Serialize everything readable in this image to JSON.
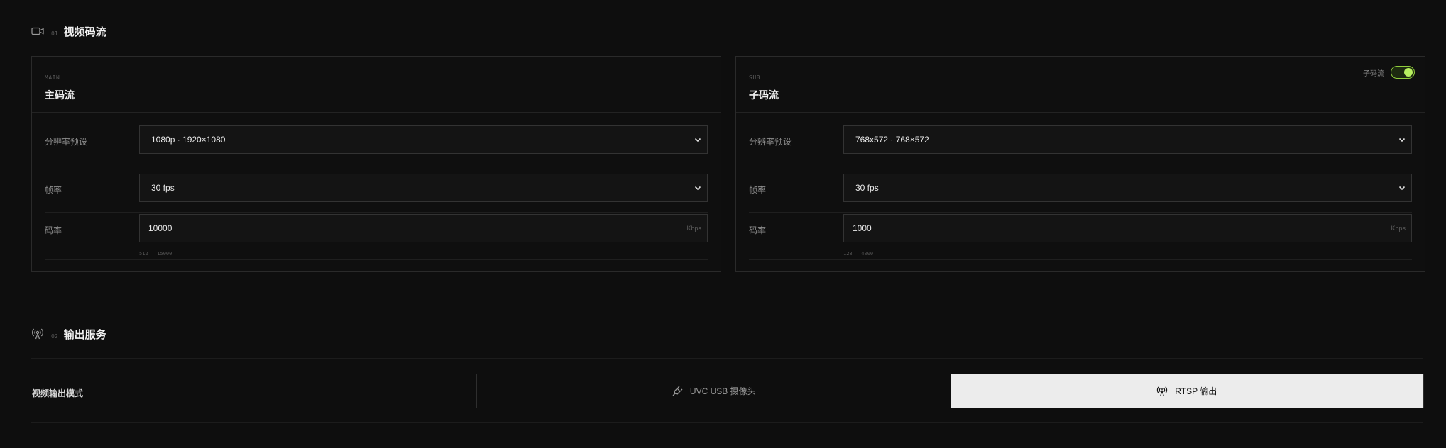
{
  "video_section": {
    "icon": "video-camera-icon",
    "number": "01",
    "title": "视频码流"
  },
  "main_stream": {
    "tag": "MAIN",
    "name": "主码流",
    "resolution_label": "分辨率预设",
    "resolution_value": "1080p · 1920×1080",
    "framerate_label": "帧率",
    "framerate_value": "30 fps",
    "bitrate_label": "码率",
    "bitrate_value": "10000",
    "bitrate_unit": "Kbps",
    "bitrate_hint": "512 – 15000"
  },
  "sub_stream": {
    "tag": "SUB",
    "name": "子码流",
    "toggle_label": "子码流",
    "toggle_on": true,
    "resolution_label": "分辨率预设",
    "resolution_value": "768x572 · 768×572",
    "framerate_label": "帧率",
    "framerate_value": "30 fps",
    "bitrate_label": "码率",
    "bitrate_value": "1000",
    "bitrate_unit": "Kbps",
    "bitrate_hint": "128 – 4000"
  },
  "output_section": {
    "icon": "broadcast-icon",
    "number": "02",
    "title": "输出服务",
    "mode_label": "视频输出模式",
    "options": [
      {
        "label": "UVC USB 摄像头",
        "icon": "usb-plug-icon",
        "selected": false
      },
      {
        "label": "RTSP 输出",
        "icon": "broadcast-icon",
        "selected": true
      }
    ]
  },
  "colors": {
    "background": "#0e0e0e",
    "accent": "#b8f060",
    "selected_segment": "#ececec"
  }
}
